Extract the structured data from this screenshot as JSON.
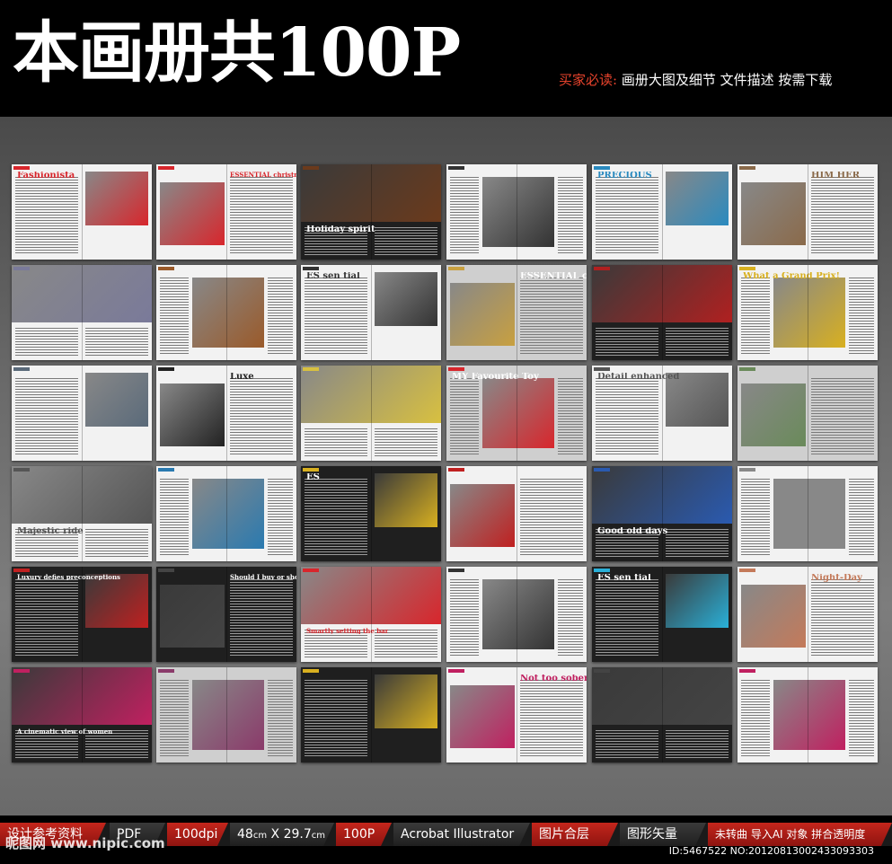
{
  "header": {
    "title": "本画册共100P",
    "subtitle_prefix": "买家必读:",
    "subtitle_text": " 画册大图及细节 文件描述 按需下载"
  },
  "colors": {
    "accent": "#c4261c",
    "background": "#6b6b6b",
    "header_bg": "#000000"
  },
  "thumbnails": [
    {
      "headline": "Fashionista",
      "theme": "white",
      "accent": "#d8262c"
    },
    {
      "headline": "ESSENTIAL christmas",
      "theme": "white",
      "accent": "#d8262c"
    },
    {
      "headline": "Holiday spirit",
      "theme": "dark",
      "accent": "#6b3a1c"
    },
    {
      "headline": "",
      "theme": "white",
      "accent": "#333333"
    },
    {
      "headline": "PRECIOUS",
      "theme": "white",
      "accent": "#2a8abf"
    },
    {
      "headline": "HIM HER",
      "theme": "white",
      "accent": "#8a6a4a"
    },
    {
      "headline": "",
      "theme": "white",
      "accent": "#7a7a9a"
    },
    {
      "headline": "",
      "theme": "white",
      "accent": "#9a5a2a"
    },
    {
      "headline": "ES sen tial",
      "theme": "white",
      "accent": "#333333"
    },
    {
      "headline": "ESSENTIAL cars",
      "theme": "gray",
      "accent": "#c8a040"
    },
    {
      "headline": "",
      "theme": "dark",
      "accent": "#b02020"
    },
    {
      "headline": "What a Grand Prix!",
      "theme": "white",
      "accent": "#d8b020"
    },
    {
      "headline": "",
      "theme": "white",
      "accent": "#5a6a7a"
    },
    {
      "headline": "Luxe",
      "theme": "white",
      "accent": "#222222"
    },
    {
      "headline": "",
      "theme": "white",
      "accent": "#d8c040"
    },
    {
      "headline": "MY Favourite Toy",
      "theme": "gray",
      "accent": "#d8262c"
    },
    {
      "headline": "Detail enhanced",
      "theme": "white",
      "accent": "#555555"
    },
    {
      "headline": "",
      "theme": "gray",
      "accent": "#6a8a5a"
    },
    {
      "headline": "Majestic ride",
      "theme": "white",
      "accent": "#555555"
    },
    {
      "headline": "",
      "theme": "white",
      "accent": "#2a7ab0"
    },
    {
      "headline": "ES",
      "theme": "dark",
      "accent": "#d8b020"
    },
    {
      "headline": "",
      "theme": "white",
      "accent": "#c02020"
    },
    {
      "headline": "Good old days",
      "theme": "dark",
      "accent": "#2a5ab0"
    },
    {
      "headline": "",
      "theme": "white",
      "accent": "#888888"
    },
    {
      "headline": "Luxury defies preconceptions",
      "theme": "dark",
      "accent": "#c02020"
    },
    {
      "headline": "Should I buy or should I sell?",
      "theme": "dark",
      "accent": "#444444"
    },
    {
      "headline": "Smartly setting the bar",
      "theme": "white",
      "accent": "#d8262c"
    },
    {
      "headline": "",
      "theme": "white",
      "accent": "#333333"
    },
    {
      "headline": "ES sen tial",
      "theme": "dark",
      "accent": "#2ab0d8"
    },
    {
      "headline": "Night-Day",
      "theme": "white",
      "accent": "#c47a5a"
    },
    {
      "headline": "A cinematic view of women",
      "theme": "dark",
      "accent": "#c02060"
    },
    {
      "headline": "",
      "theme": "gray",
      "accent": "#8a3a6a"
    },
    {
      "headline": "",
      "theme": "dark",
      "accent": "#d8b020"
    },
    {
      "headline": "Not too sober",
      "theme": "white",
      "accent": "#c02060"
    },
    {
      "headline": "",
      "theme": "dark",
      "accent": "#444444"
    },
    {
      "headline": "",
      "theme": "white",
      "accent": "#c02060"
    }
  ],
  "footer": {
    "tags": [
      "设计参考资料",
      "PDF",
      "100dpi",
      "48cm X 29.7cm",
      "100P",
      "Acrobat Illustrator",
      "图片合层",
      "图形矢量",
      "未转曲 导入AI 对象 拼合透明度"
    ],
    "size_w": "48",
    "size_unit_a": "cm",
    "size_h": " X 29.7",
    "size_unit_b": "cm",
    "watermark": "昵图网 www.nipic.com",
    "id_text": "ID:5467522 NO:20120813002433093303"
  }
}
